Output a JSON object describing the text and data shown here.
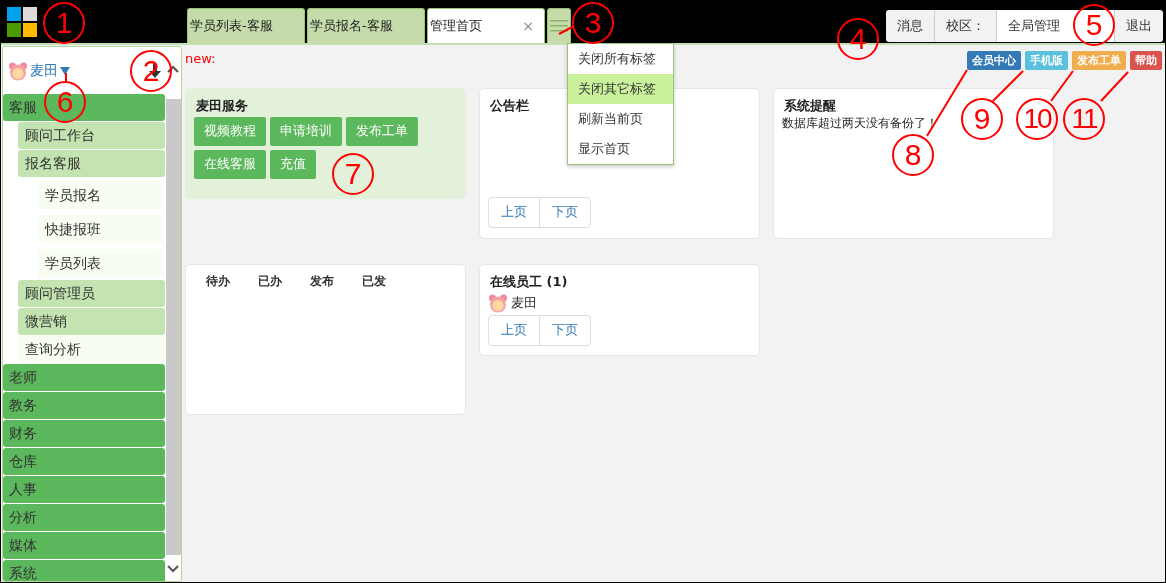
{
  "top_bar": {
    "tabs": [
      {
        "label": "学员列表-客服",
        "selected": false
      },
      {
        "label": "学员报名-客服",
        "selected": false
      },
      {
        "label": "管理首页",
        "selected": true,
        "close": "×"
      }
    ],
    "tab_menu": [
      {
        "label": "关闭所有标签",
        "selected": false
      },
      {
        "label": "关闭其它标签",
        "selected": true
      },
      {
        "label": "刷新当前页",
        "selected": false
      },
      {
        "label": "显示首页",
        "selected": false
      }
    ],
    "actions": [
      {
        "label": "消息",
        "kind": "button"
      },
      {
        "label": "校区：",
        "kind": "label"
      },
      {
        "label": "全局管理",
        "kind": "value"
      },
      {
        "label": "退出",
        "kind": "button"
      }
    ]
  },
  "sidebar": {
    "user": "麦田",
    "menu": [
      {
        "label": "客服",
        "kind": "group",
        "children": [
          {
            "label": "顾问工作台",
            "kind": "group"
          },
          {
            "label": "报名客服",
            "kind": "group",
            "children": [
              {
                "label": "学员报名",
                "kind": "link"
              },
              {
                "label": "快捷报班",
                "kind": "link"
              },
              {
                "label": "学员列表",
                "kind": "link"
              }
            ]
          },
          {
            "label": "顾问管理员",
            "kind": "group"
          },
          {
            "label": "微营销",
            "kind": "group"
          },
          {
            "label": "查询分析",
            "kind": "link"
          }
        ]
      },
      {
        "label": "老师",
        "kind": "group"
      },
      {
        "label": "教务",
        "kind": "group"
      },
      {
        "label": "财务",
        "kind": "group"
      },
      {
        "label": "仓库",
        "kind": "group"
      },
      {
        "label": "人事",
        "kind": "group"
      },
      {
        "label": "分析",
        "kind": "group"
      },
      {
        "label": "媒体",
        "kind": "group"
      },
      {
        "label": "系统",
        "kind": "group"
      }
    ]
  },
  "content": {
    "notice": "new:",
    "tags": [
      {
        "label": "会员中心",
        "color": "#337ab7"
      },
      {
        "label": "手机版",
        "color": "#5bc0de"
      },
      {
        "label": "发布工单",
        "color": "#f0ad4e"
      },
      {
        "label": "帮助",
        "color": "#d9534f"
      }
    ],
    "panels": [
      {
        "kind": "service",
        "title": "麦田服务",
        "buttons": [
          "视频教程",
          "申请培训",
          "发布工单",
          "在线客服",
          "充值"
        ]
      },
      {
        "kind": "board",
        "title": "公告栏",
        "pager": [
          "上页",
          "下页"
        ]
      },
      {
        "kind": "alert",
        "title": "系统提醒",
        "message": "数据库超过两天没有备份了！"
      },
      {
        "kind": "tabs",
        "labels": [
          "待办",
          "已办",
          "发布",
          "已发"
        ]
      },
      {
        "kind": "staff",
        "title": "在线员工 (1)",
        "users": [
          "麦田"
        ],
        "pager": [
          "上页",
          "下页"
        ]
      }
    ]
  },
  "annotations": [
    {
      "label": "1"
    },
    {
      "label": "2"
    },
    {
      "label": "3"
    },
    {
      "label": "4"
    },
    {
      "label": "5"
    },
    {
      "label": "6"
    },
    {
      "label": "7"
    },
    {
      "label": "8"
    },
    {
      "label": "9"
    },
    {
      "label": "10"
    },
    {
      "label": "11"
    }
  ]
}
